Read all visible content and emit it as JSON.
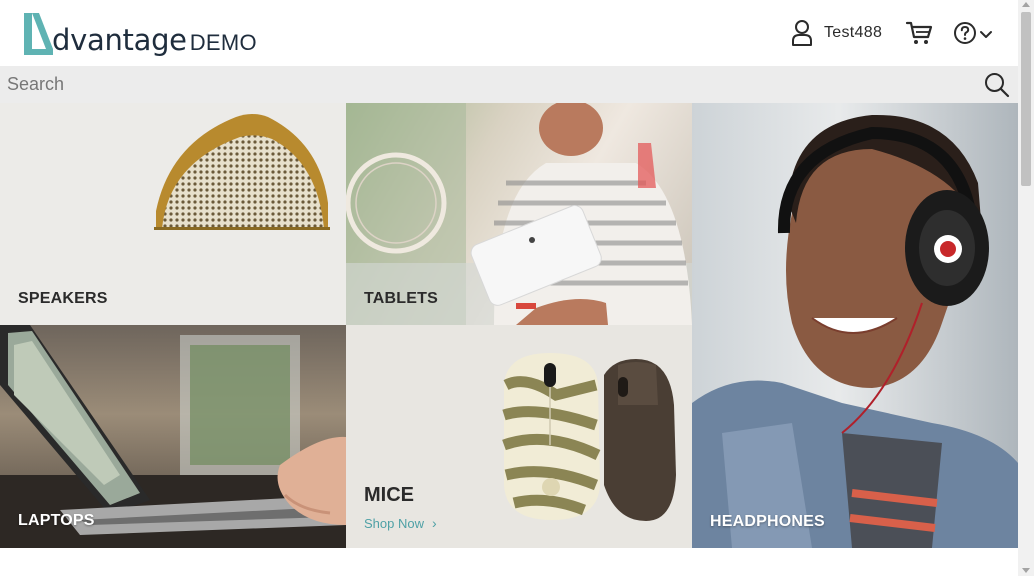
{
  "brand": {
    "name": "dvantage",
    "suffix": "DEMO",
    "icon": "advantage-logo-icon",
    "accent_color": "#5fb3b3",
    "dark_color": "#1f2d3d"
  },
  "header": {
    "user_icon": "user-icon",
    "user_name": "Test488",
    "cart_icon": "cart-icon",
    "help_icon": "help-icon",
    "menu_icon": "chevron-down-icon"
  },
  "search": {
    "placeholder": "Search",
    "icon": "search-icon"
  },
  "categories": {
    "speakers": {
      "label": "SPEAKERS"
    },
    "tablets": {
      "label": "TABLETS"
    },
    "headphones": {
      "label": "HEADPHONES"
    },
    "laptops": {
      "label": "LAPTOPS"
    },
    "mice": {
      "label": "MICE",
      "cta": "Shop Now",
      "cta_icon": "chevron-right-icon",
      "cta_color": "#4fa1a6"
    }
  }
}
